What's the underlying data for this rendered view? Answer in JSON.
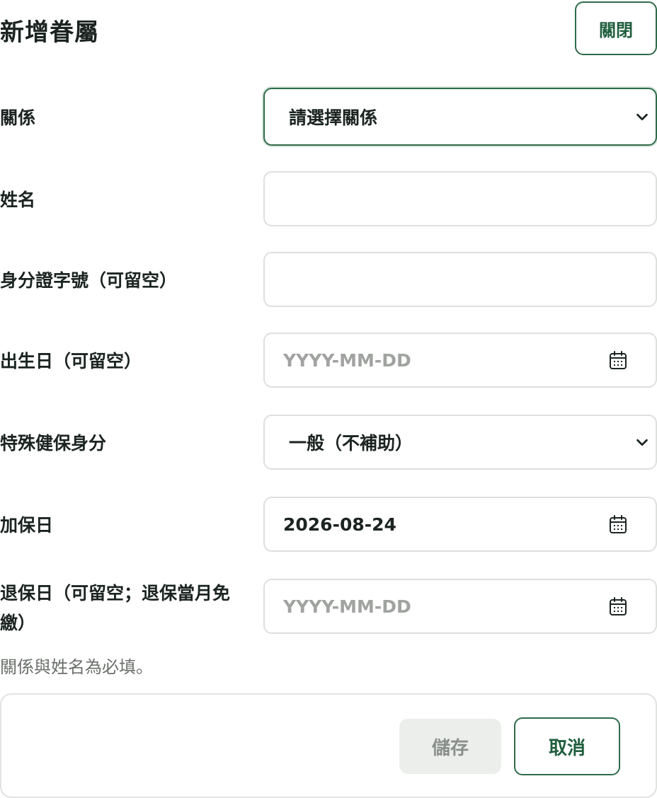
{
  "header": {
    "title": "新增眷屬",
    "close_label": "關閉"
  },
  "form": {
    "relationship": {
      "label": "關係",
      "selected": "請選擇關係"
    },
    "name": {
      "label": "姓名",
      "value": ""
    },
    "id_number": {
      "label": "身分證字號（可留空）",
      "value": ""
    },
    "birthdate": {
      "label": "出生日（可留空）",
      "placeholder": "YYYY-MM-DD",
      "value": ""
    },
    "special_status": {
      "label": "特殊健保身分",
      "selected": "一般（不補助）"
    },
    "enroll_date": {
      "label": "加保日",
      "value": "2026-08-24"
    },
    "withdraw_date": {
      "label": "退保日（可留空；退保當月免繳）",
      "placeholder": "YYYY-MM-DD",
      "value": ""
    }
  },
  "hint": "關係與姓名為必填。",
  "footer": {
    "save_label": "儲存",
    "cancel_label": "取消"
  },
  "colors": {
    "accent": "#2f6b4a",
    "border": "#dde0dd",
    "disabled_bg": "#eceeec"
  },
  "icons": {
    "select": "chevron-down-icon",
    "date": "calendar-icon"
  }
}
